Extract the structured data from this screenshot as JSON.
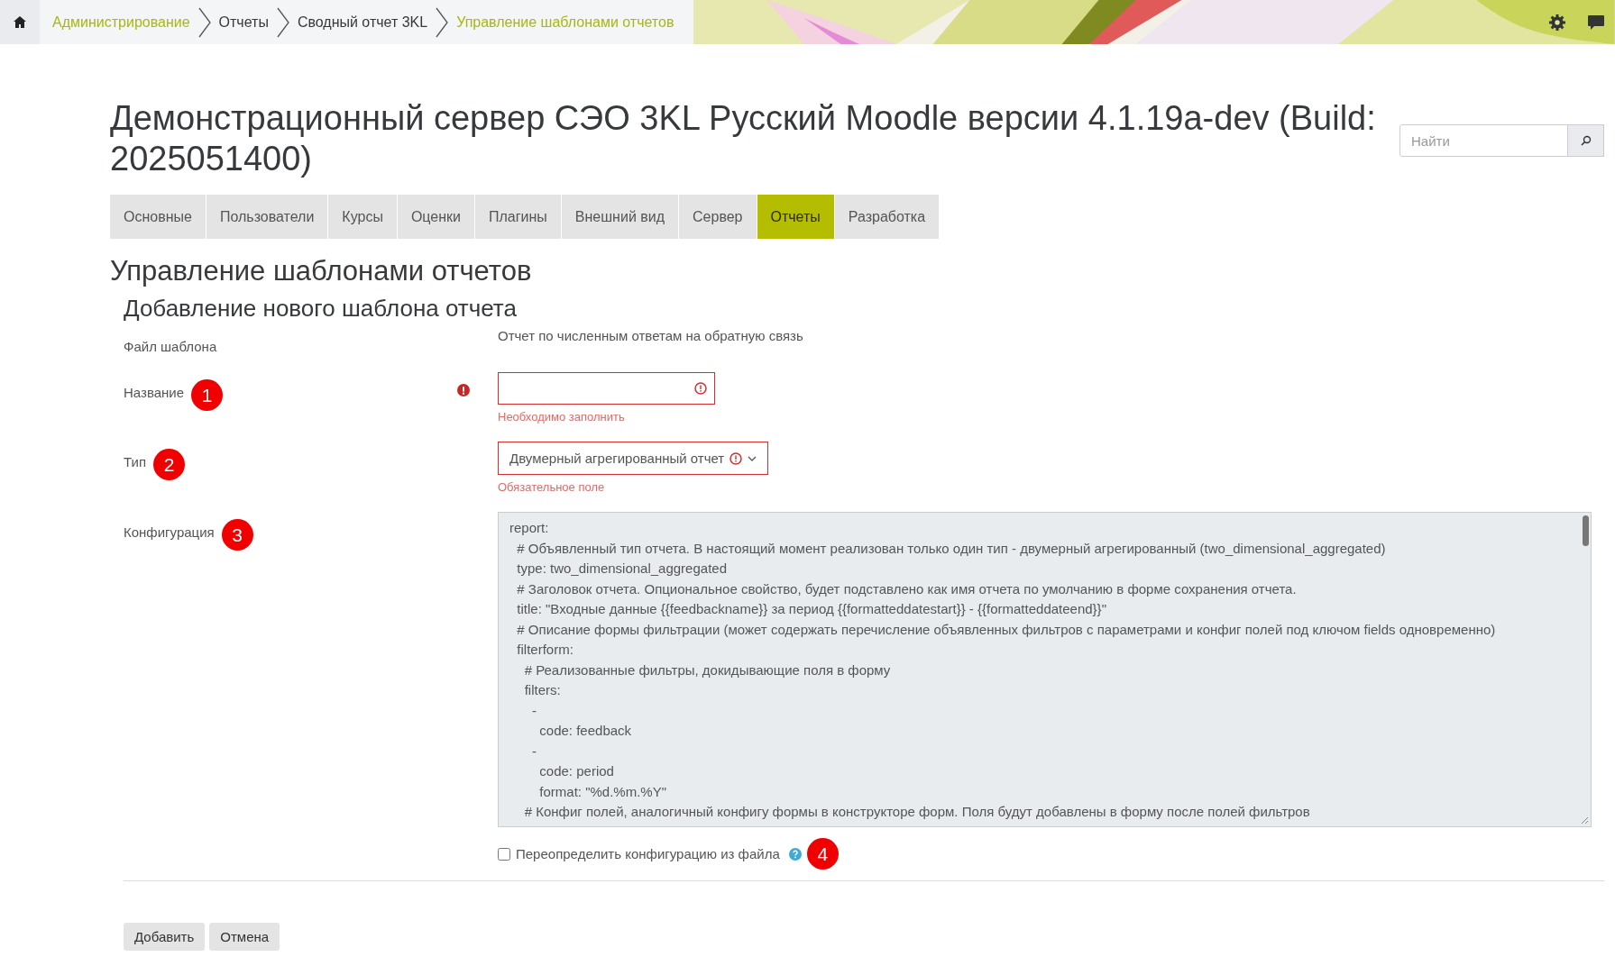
{
  "breadcrumbs": [
    {
      "label": "Администрирование",
      "highlighted": true
    },
    {
      "label": "Отчеты",
      "highlighted": false
    },
    {
      "label": "Сводный отчет 3KL",
      "highlighted": false
    },
    {
      "label": "Управление шаблонами отчетов",
      "highlighted": true
    }
  ],
  "site_title": "Демонстрационный сервер СЭО 3KL Русский Moodle версии 4.1.19a-dev (Build: 2025051400)",
  "search": {
    "placeholder": "Найти"
  },
  "tabs": [
    {
      "label": "Основные",
      "selected": false
    },
    {
      "label": "Пользователи",
      "selected": false
    },
    {
      "label": "Курсы",
      "selected": false
    },
    {
      "label": "Оценки",
      "selected": false
    },
    {
      "label": "Плагины",
      "selected": false
    },
    {
      "label": "Внешний вид",
      "selected": false
    },
    {
      "label": "Сервер",
      "selected": false
    },
    {
      "label": "Отчеты",
      "selected": true
    },
    {
      "label": "Разработка",
      "selected": false
    }
  ],
  "page_heading": "Управление шаблонами отчетов",
  "section_heading": "Добавление нового шаблона отчета",
  "fields": [
    {
      "kind": "static",
      "label": "Файл шаблона",
      "value": "Отчет по численным ответам на обратную связь"
    },
    {
      "kind": "text",
      "label": "Название",
      "marker": "1",
      "required": true,
      "error": "Необходимо заполнить"
    },
    {
      "kind": "select",
      "label": "Тип",
      "marker": "2",
      "required": false,
      "value": "Двумерный агрегированный отчет",
      "error": "Обязательное поле"
    },
    {
      "kind": "textarea",
      "label": "Конфигурация",
      "marker": "3",
      "lines": [
        "report:",
        "  # Объявленный тип отчета. В настоящий момент реализован только один тип - двумерный агрегированный (two_dimensional_aggregated)",
        "  type: two_dimensional_aggregated",
        "  # Заголовок отчета. Опциональное свойство, будет подставлено как имя отчета по умолчанию в форме сохранения отчета.",
        "  title: \"Входные данные {{feedbackname}} за период {{formatteddatestart}} - {{formatteddateend}}\"",
        "  # Описание формы фильтрации (может содержать перечисление объявленных фильтров с параметрами и конфиг полей под ключом fields одновременно)",
        "  filterform:",
        "    # Реализованные фильтры, докидывающие поля в форму",
        "    filters:",
        "      -",
        "        code: feedback",
        "      -",
        "        code: period",
        "        format: \"%d.%m.%Y\"",
        "    # Конфиг полей, аналогичный конфигу формы в конструкторе форм. Поля будут добавлены в форму после полей фильтров"
      ]
    }
  ],
  "override": {
    "label": "Переопределить конфигурацию из файла",
    "checked": false,
    "marker": "4"
  },
  "buttons": [
    "Добавить",
    "Отмена"
  ]
}
